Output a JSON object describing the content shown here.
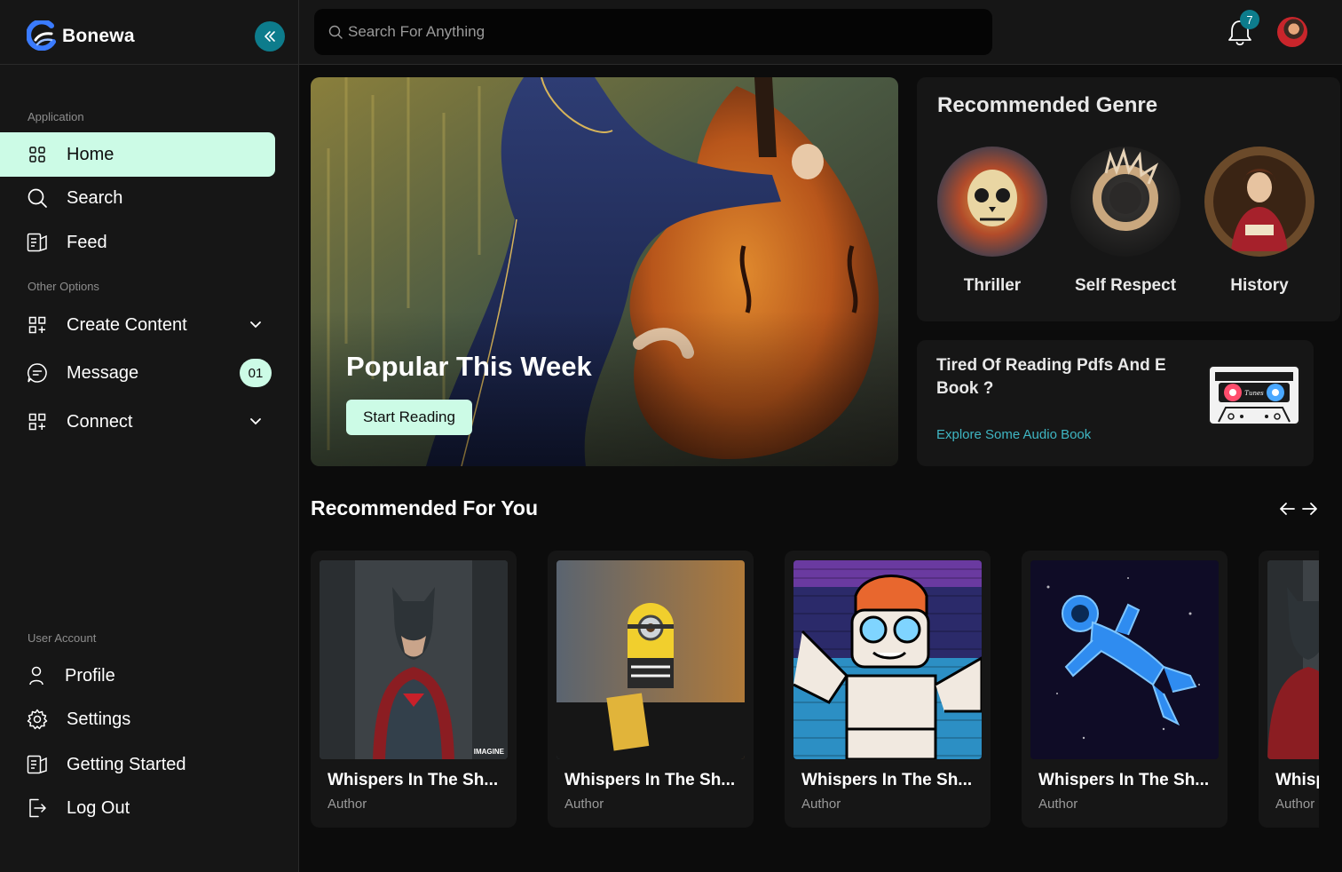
{
  "brand": {
    "name": "Bonewa",
    "accent": "#0d7c8c",
    "mint": "#ccfbe6"
  },
  "sidebar": {
    "section_application": "Application",
    "section_other": "Other Options",
    "section_account": "User Account",
    "items": [
      {
        "label": "Home",
        "icon": "grid-icon",
        "active": true
      },
      {
        "label": "Search",
        "icon": "search-icon"
      },
      {
        "label": "Feed",
        "icon": "feed-icon"
      },
      {
        "label": "Create Content",
        "icon": "grid-plus-icon"
      },
      {
        "label": "Message",
        "icon": "chat-icon",
        "badge": "01"
      },
      {
        "label": "Connect",
        "icon": "grid-plus-icon"
      }
    ],
    "account_items": [
      {
        "label": "Profile",
        "icon": "user-icon"
      },
      {
        "label": "Settings",
        "icon": "gear-icon"
      },
      {
        "label": "Getting Started",
        "icon": "feed-icon"
      },
      {
        "label": "Log Out",
        "icon": "logout-icon"
      }
    ]
  },
  "topbar": {
    "search_placeholder": "Search For Anything",
    "notification_count": "7"
  },
  "hero": {
    "title": "Popular This Week",
    "button": "Start Reading"
  },
  "genres": {
    "title": "Recommended Genre",
    "items": [
      "Thriller",
      "Self Respect",
      "History"
    ]
  },
  "audio": {
    "title": "Tired Of Reading Pdfs And E Book ?",
    "link": "Explore Some Audio Book",
    "cassette_label": "Tunes"
  },
  "recommended": {
    "title": "Recommended For You",
    "books": [
      {
        "title": "Whispers In The Sh...",
        "author": "Author",
        "cover_tag": "IMAGINE"
      },
      {
        "title": "Whispers In The Sh...",
        "author": "Author"
      },
      {
        "title": "Whispers In The Sh...",
        "author": "Author"
      },
      {
        "title": "Whispers In The Sh...",
        "author": "Author"
      },
      {
        "title": "Whispers In The Sh...",
        "author": "Author"
      }
    ]
  }
}
